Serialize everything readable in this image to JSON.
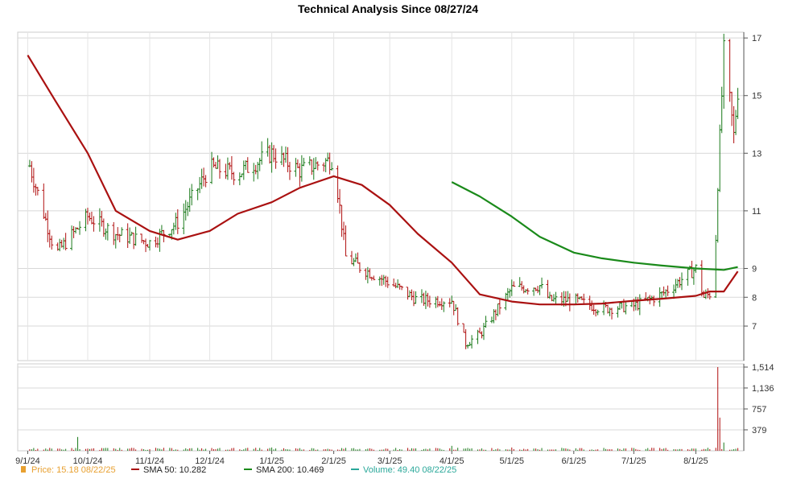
{
  "chart_data": {
    "type": "line",
    "title": "Technical Analysis Since 08/27/24",
    "x_tick_labels": [
      "9/1/24",
      "10/1/24",
      "11/1/24",
      "12/1/24",
      "1/1/25",
      "2/1/25",
      "3/1/25",
      "4/1/25",
      "5/1/25",
      "6/1/25",
      "7/1/25",
      "8/1/25"
    ],
    "price_axis": {
      "ylim": [
        5.8,
        17.2
      ],
      "ticks": [
        7,
        8,
        9,
        11,
        13,
        15,
        17
      ]
    },
    "volume_axis": {
      "ylim": [
        0,
        1514
      ],
      "ticks": [
        "379",
        "757",
        "1,136",
        "1,514"
      ],
      "tick_values": [
        379,
        757,
        1136,
        1514
      ]
    },
    "grid": true,
    "colors": {
      "up": "#1a7a1a",
      "down": "#b01010",
      "sma50": "#aa1111",
      "sma200": "#1a8a1a",
      "price_legend": "#e8a030",
      "volume": "#2aa89a"
    },
    "price_series": {
      "name": "Price",
      "dates": [
        "9/1/24",
        "9/15/24",
        "10/1/24",
        "10/15/24",
        "11/1/24",
        "11/15/24",
        "12/1/24",
        "12/15/24",
        "1/1/25",
        "1/15/25",
        "2/1/25",
        "2/7/25",
        "2/15/25",
        "3/1/25",
        "3/15/25",
        "4/1/25",
        "4/8/25",
        "4/15/25",
        "5/1/25",
        "5/15/25",
        "5/20/25",
        "6/1/25",
        "6/15/25",
        "7/1/25",
        "7/15/25",
        "8/1/25",
        "8/5/25",
        "8/10/25",
        "8/12/25",
        "8/15/25",
        "8/18/25",
        "8/20/25",
        "8/22/25"
      ],
      "values": [
        12.8,
        9.5,
        10.8,
        10.2,
        9.9,
        10.6,
        12.5,
        12.3,
        13.0,
        12.4,
        12.8,
        9.4,
        9.0,
        8.5,
        7.9,
        7.9,
        6.4,
        6.7,
        8.3,
        8.4,
        7.9,
        7.9,
        7.6,
        7.7,
        8.1,
        9.0,
        8.0,
        8.2,
        12.0,
        16.5,
        14.8,
        13.6,
        15.18
      ]
    },
    "sma50": {
      "name": "SMA 50",
      "dates": [
        "9/1/24",
        "9/8/24",
        "9/15/24",
        "10/1/24",
        "10/15/24",
        "11/1/24",
        "11/15/24",
        "12/1/24",
        "12/15/24",
        "1/1/25",
        "1/15/25",
        "2/1/25",
        "2/15/25",
        "3/1/25",
        "3/15/25",
        "4/1/25",
        "4/15/25",
        "5/1/25",
        "5/15/25",
        "6/1/25",
        "6/15/25",
        "7/1/25",
        "7/15/25",
        "8/1/25",
        "8/8/25",
        "8/15/25",
        "8/22/25"
      ],
      "values": [
        16.4,
        15.6,
        14.8,
        13.0,
        11.0,
        10.3,
        10.0,
        10.3,
        10.9,
        11.3,
        11.8,
        12.2,
        11.9,
        11.2,
        10.2,
        9.2,
        8.1,
        7.85,
        7.75,
        7.75,
        7.78,
        7.88,
        7.95,
        8.05,
        8.2,
        8.2,
        8.9
      ]
    },
    "sma200": {
      "name": "SMA 200",
      "dates": [
        "4/1/25",
        "4/15/25",
        "5/1/25",
        "5/15/25",
        "6/1/25",
        "6/15/25",
        "7/1/25",
        "7/15/25",
        "8/1/25",
        "8/15/25",
        "8/22/25"
      ],
      "values": [
        12.0,
        11.5,
        10.8,
        10.1,
        9.55,
        9.35,
        9.2,
        9.1,
        9.0,
        8.95,
        9.05
      ]
    },
    "volume": {
      "name": "Volume",
      "dates": [
        "9/1/24",
        "9/26/24",
        "10/1/24",
        "11/1/24",
        "12/1/24",
        "1/1/25",
        "2/1/25",
        "3/1/25",
        "4/1/25",
        "5/1/25",
        "6/1/25",
        "7/1/25",
        "8/1/25",
        "8/12/25",
        "8/13/25",
        "8/15/25",
        "8/22/25"
      ],
      "values": [
        20,
        250,
        40,
        30,
        70,
        60,
        30,
        80,
        90,
        60,
        40,
        50,
        40,
        1514,
        600,
        150,
        49.4
      ]
    },
    "legend": [
      {
        "marker": "square",
        "color": "#e8a030",
        "text": "Price: 15.18  08/22/25"
      },
      {
        "marker": "line",
        "color": "#aa1111",
        "text": "SMA 50: 10.282"
      },
      {
        "marker": "line",
        "color": "#1a8a1a",
        "text": "SMA 200: 10.469"
      },
      {
        "marker": "line",
        "color": "#2aa89a",
        "text": "Volume: 49.40  08/22/25"
      }
    ]
  }
}
